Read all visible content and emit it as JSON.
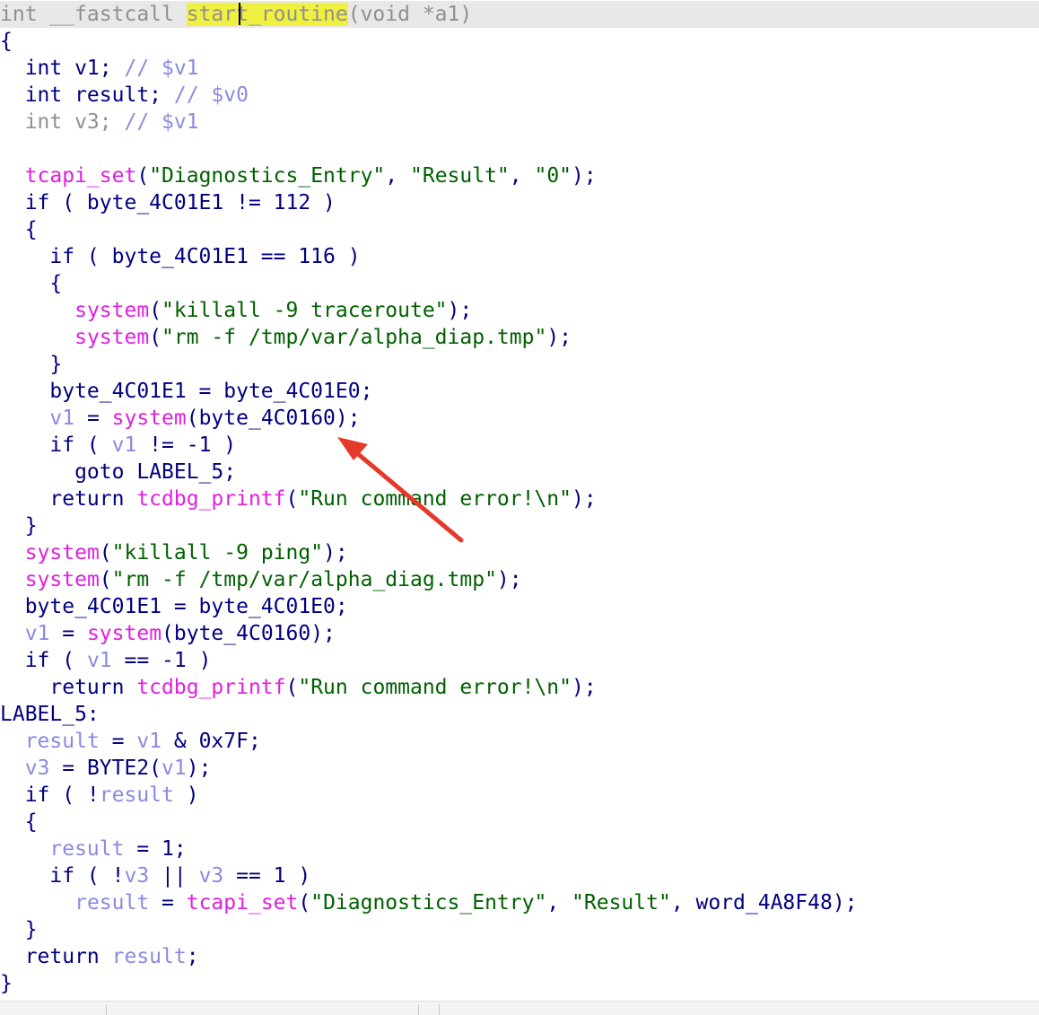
{
  "editor": {
    "lines": [
      {
        "hl": true,
        "tokens": [
          {
            "t": "int __fastcall ",
            "c": "hdr"
          },
          {
            "t": "start_routine",
            "c": "sel"
          },
          {
            "t": "(void *a1)",
            "c": "hdr"
          }
        ]
      },
      {
        "tokens": [
          {
            "t": "{",
            "c": "plain"
          }
        ]
      },
      {
        "tokens": [
          {
            "t": "  int v1; ",
            "c": "plain"
          },
          {
            "t": "// $v1",
            "c": "cmt"
          }
        ]
      },
      {
        "tokens": [
          {
            "t": "  int result; ",
            "c": "plain"
          },
          {
            "t": "// $v0",
            "c": "cmt"
          }
        ]
      },
      {
        "tokens": [
          {
            "t": "  int v3; ",
            "c": "hdr"
          },
          {
            "t": "// $v1",
            "c": "cmt"
          }
        ]
      },
      {
        "tokens": []
      },
      {
        "tokens": [
          {
            "t": "  ",
            "c": "plain"
          },
          {
            "t": "tcapi_set",
            "c": "gfn"
          },
          {
            "t": "(",
            "c": "plain"
          },
          {
            "t": "\"Diagnostics_Entry\"",
            "c": "str"
          },
          {
            "t": ", ",
            "c": "plain"
          },
          {
            "t": "\"Result\"",
            "c": "str"
          },
          {
            "t": ", ",
            "c": "plain"
          },
          {
            "t": "\"0\"",
            "c": "str"
          },
          {
            "t": ");",
            "c": "plain"
          }
        ]
      },
      {
        "tokens": [
          {
            "t": "  if ( byte_4C01E1 != 112 )",
            "c": "plain"
          }
        ]
      },
      {
        "tokens": [
          {
            "t": "  {",
            "c": "plain"
          }
        ]
      },
      {
        "tokens": [
          {
            "t": "    if ( byte_4C01E1 == 116 )",
            "c": "plain"
          }
        ]
      },
      {
        "tokens": [
          {
            "t": "    {",
            "c": "plain"
          }
        ]
      },
      {
        "tokens": [
          {
            "t": "      ",
            "c": "plain"
          },
          {
            "t": "system",
            "c": "gfn"
          },
          {
            "t": "(",
            "c": "plain"
          },
          {
            "t": "\"killall -9 traceroute\"",
            "c": "str"
          },
          {
            "t": ");",
            "c": "plain"
          }
        ]
      },
      {
        "tokens": [
          {
            "t": "      ",
            "c": "plain"
          },
          {
            "t": "system",
            "c": "gfn"
          },
          {
            "t": "(",
            "c": "plain"
          },
          {
            "t": "\"rm -f /tmp/var/alpha_diap.tmp\"",
            "c": "str"
          },
          {
            "t": ");",
            "c": "plain"
          }
        ]
      },
      {
        "tokens": [
          {
            "t": "    }",
            "c": "plain"
          }
        ]
      },
      {
        "tokens": [
          {
            "t": "    byte_4C01E1 = byte_4C01E0;",
            "c": "plain"
          }
        ]
      },
      {
        "tokens": [
          {
            "t": "    ",
            "c": "plain"
          },
          {
            "t": "v1",
            "c": "var"
          },
          {
            "t": " = ",
            "c": "plain"
          },
          {
            "t": "system",
            "c": "gfn"
          },
          {
            "t": "(byte_4C0160);",
            "c": "plain"
          }
        ]
      },
      {
        "tokens": [
          {
            "t": "    if ( ",
            "c": "plain"
          },
          {
            "t": "v1",
            "c": "var"
          },
          {
            "t": " != -1 )",
            "c": "plain"
          }
        ]
      },
      {
        "tokens": [
          {
            "t": "      goto LABEL_5;",
            "c": "plain"
          }
        ]
      },
      {
        "tokens": [
          {
            "t": "    return ",
            "c": "plain"
          },
          {
            "t": "tcdbg_printf",
            "c": "gfn"
          },
          {
            "t": "(",
            "c": "plain"
          },
          {
            "t": "\"Run command error!\\n\"",
            "c": "str"
          },
          {
            "t": ");",
            "c": "plain"
          }
        ]
      },
      {
        "tokens": [
          {
            "t": "  }",
            "c": "plain"
          }
        ]
      },
      {
        "tokens": [
          {
            "t": "  ",
            "c": "plain"
          },
          {
            "t": "system",
            "c": "gfn"
          },
          {
            "t": "(",
            "c": "plain"
          },
          {
            "t": "\"killall -9 ping\"",
            "c": "str"
          },
          {
            "t": ");",
            "c": "plain"
          }
        ]
      },
      {
        "tokens": [
          {
            "t": "  ",
            "c": "plain"
          },
          {
            "t": "system",
            "c": "gfn"
          },
          {
            "t": "(",
            "c": "plain"
          },
          {
            "t": "\"rm -f /tmp/var/alpha_diag.tmp\"",
            "c": "str"
          },
          {
            "t": ");",
            "c": "plain"
          }
        ]
      },
      {
        "tokens": [
          {
            "t": "  byte_4C01E1 = byte_4C01E0;",
            "c": "plain"
          }
        ]
      },
      {
        "tokens": [
          {
            "t": "  ",
            "c": "plain"
          },
          {
            "t": "v1",
            "c": "var"
          },
          {
            "t": " = ",
            "c": "plain"
          },
          {
            "t": "system",
            "c": "gfn"
          },
          {
            "t": "(byte_4C0160);",
            "c": "plain"
          }
        ]
      },
      {
        "tokens": [
          {
            "t": "  if ( ",
            "c": "plain"
          },
          {
            "t": "v1",
            "c": "var"
          },
          {
            "t": " == -1 )",
            "c": "plain"
          }
        ]
      },
      {
        "tokens": [
          {
            "t": "    return ",
            "c": "plain"
          },
          {
            "t": "tcdbg_printf",
            "c": "gfn"
          },
          {
            "t": "(",
            "c": "plain"
          },
          {
            "t": "\"Run command error!\\n\"",
            "c": "str"
          },
          {
            "t": ");",
            "c": "plain"
          }
        ]
      },
      {
        "tokens": [
          {
            "t": "LABEL_5:",
            "c": "lbl"
          }
        ]
      },
      {
        "tokens": [
          {
            "t": "  ",
            "c": "plain"
          },
          {
            "t": "result",
            "c": "var"
          },
          {
            "t": " = ",
            "c": "plain"
          },
          {
            "t": "v1",
            "c": "var"
          },
          {
            "t": " & 0x7F;",
            "c": "plain"
          }
        ]
      },
      {
        "tokens": [
          {
            "t": "  ",
            "c": "plain"
          },
          {
            "t": "v3",
            "c": "var"
          },
          {
            "t": " = BYTE2(",
            "c": "plain"
          },
          {
            "t": "v1",
            "c": "var"
          },
          {
            "t": ");",
            "c": "plain"
          }
        ]
      },
      {
        "tokens": [
          {
            "t": "  if ( !",
            "c": "plain"
          },
          {
            "t": "result",
            "c": "var"
          },
          {
            "t": " )",
            "c": "plain"
          }
        ]
      },
      {
        "tokens": [
          {
            "t": "  {",
            "c": "plain"
          }
        ]
      },
      {
        "tokens": [
          {
            "t": "    ",
            "c": "plain"
          },
          {
            "t": "result",
            "c": "var"
          },
          {
            "t": " = 1;",
            "c": "plain"
          }
        ]
      },
      {
        "tokens": [
          {
            "t": "    if ( !",
            "c": "plain"
          },
          {
            "t": "v3",
            "c": "var"
          },
          {
            "t": " || ",
            "c": "plain"
          },
          {
            "t": "v3",
            "c": "var"
          },
          {
            "t": " == 1 )",
            "c": "plain"
          }
        ]
      },
      {
        "tokens": [
          {
            "t": "      ",
            "c": "plain"
          },
          {
            "t": "result",
            "c": "var"
          },
          {
            "t": " = ",
            "c": "plain"
          },
          {
            "t": "tcapi_set",
            "c": "gfn"
          },
          {
            "t": "(",
            "c": "plain"
          },
          {
            "t": "\"Diagnostics_Entry\"",
            "c": "str"
          },
          {
            "t": ", ",
            "c": "plain"
          },
          {
            "t": "\"Result\"",
            "c": "str"
          },
          {
            "t": ", word_4A8F48);",
            "c": "plain"
          }
        ]
      },
      {
        "tokens": [
          {
            "t": "  }",
            "c": "plain"
          }
        ]
      },
      {
        "tokens": [
          {
            "t": "  return ",
            "c": "plain"
          },
          {
            "t": "result",
            "c": "var"
          },
          {
            "t": ";",
            "c": "plain"
          }
        ]
      },
      {
        "tokens": [
          {
            "t": "}",
            "c": "plain"
          }
        ]
      }
    ]
  },
  "colors": {
    "default_text": "#000080",
    "function_call": "#e020e0",
    "variable": "#8a8ae0",
    "string": "#006000",
    "selection": "#f0f040",
    "arrow": "#e53a2a"
  }
}
